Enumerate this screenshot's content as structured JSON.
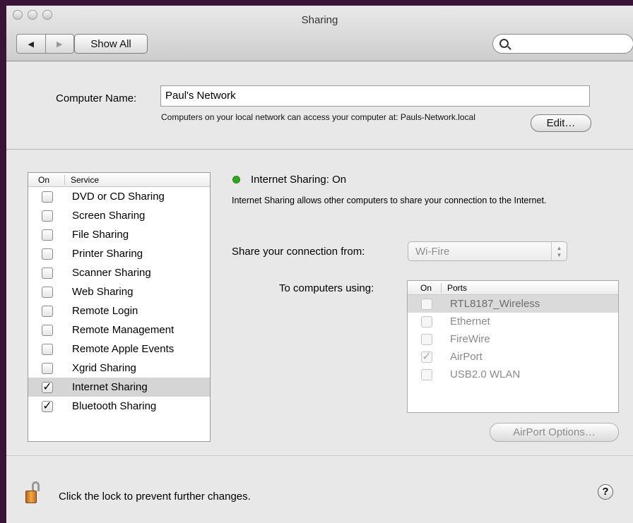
{
  "window": {
    "title": "Sharing"
  },
  "toolbar": {
    "back_icon": "◀",
    "forward_icon": "▶",
    "show_all_label": "Show All",
    "search_placeholder": ""
  },
  "computer_name": {
    "label": "Computer Name:",
    "value": "Paul's Network",
    "description": "Computers on your local network can access your computer at: Pauls-Network.local",
    "edit_label": "Edit…"
  },
  "services": {
    "header_on": "On",
    "header_service": "Service",
    "items": [
      {
        "label": "DVD or CD Sharing",
        "checked": false
      },
      {
        "label": "Screen Sharing",
        "checked": false
      },
      {
        "label": "File Sharing",
        "checked": false
      },
      {
        "label": "Printer Sharing",
        "checked": false
      },
      {
        "label": "Scanner Sharing",
        "checked": false
      },
      {
        "label": "Web Sharing",
        "checked": false
      },
      {
        "label": "Remote Login",
        "checked": false
      },
      {
        "label": "Remote Management",
        "checked": false
      },
      {
        "label": "Remote Apple Events",
        "checked": false
      },
      {
        "label": "Xgrid Sharing",
        "checked": false
      },
      {
        "label": "Internet Sharing",
        "checked": true,
        "selected": true
      },
      {
        "label": "Bluetooth Sharing",
        "checked": true
      }
    ]
  },
  "detail": {
    "status_label": "Internet Sharing: On",
    "status_color": "#2ea81a",
    "description": "Internet Sharing allows other computers to share your connection to the Internet.",
    "share_from_label": "Share your connection from:",
    "share_from_value": "Wi-Fire",
    "to_computers_label": "To computers using:",
    "ports_header_on": "On",
    "ports_header_ports": "Ports",
    "ports": [
      {
        "label": "RTL8187_Wireless",
        "checked": false,
        "selected": true
      },
      {
        "label": "Ethernet",
        "checked": false
      },
      {
        "label": "FireWire",
        "checked": false
      },
      {
        "label": "AirPort",
        "checked": true
      },
      {
        "label": "USB2.0 WLAN",
        "checked": false
      }
    ],
    "airport_options_label": "AirPort Options…"
  },
  "footer": {
    "lock_icon": "lock-open-icon",
    "lock_text": "Click the lock to prevent further changes.",
    "help_label": "?"
  }
}
